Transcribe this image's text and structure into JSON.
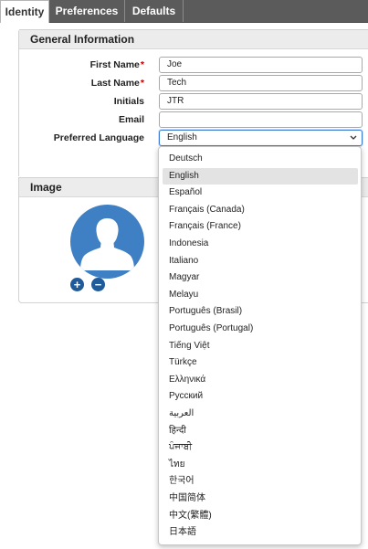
{
  "tabs": [
    {
      "label": "Identity",
      "active": true
    },
    {
      "label": "Preferences",
      "active": false
    },
    {
      "label": "Defaults",
      "active": false
    }
  ],
  "general": {
    "header": "General Information",
    "fields": [
      {
        "label": "First Name",
        "required": true,
        "value": "Joe"
      },
      {
        "label": "Last Name",
        "required": true,
        "value": "Tech"
      },
      {
        "label": "Initials",
        "required": false,
        "value": "JTR"
      },
      {
        "label": "Email",
        "required": false,
        "value": ""
      }
    ],
    "language": {
      "label": "Preferred Language",
      "value": "English"
    }
  },
  "image": {
    "header": "Image",
    "add_glyph": "+",
    "remove_glyph": "−"
  },
  "language_options": [
    "Deutsch",
    "English",
    "Español",
    "Français (Canada)",
    "Français (France)",
    "Indonesia",
    "Italiano",
    "Magyar",
    "Melayu",
    "Português (Brasil)",
    "Português (Portugal)",
    "Tiếng Việt",
    "Türkçe",
    "Ελληνικά",
    "Русский",
    "العربية",
    "हिन्दी",
    "ਪੰਜਾਬੀ",
    "ไทย",
    "한국어",
    "中国简体",
    "中文(繁體)",
    "日本語"
  ],
  "selected_option": "English",
  "colors": {
    "tabbar": "#5b5b5b",
    "required": "#c00000",
    "avatar": "#3f7fc4",
    "focus": "#3a7bd5"
  },
  "icons": {
    "chevron": "chevron-down-icon",
    "avatar": "user-silhouette-icon",
    "add": "plus-circle-icon",
    "remove": "minus-circle-icon"
  }
}
